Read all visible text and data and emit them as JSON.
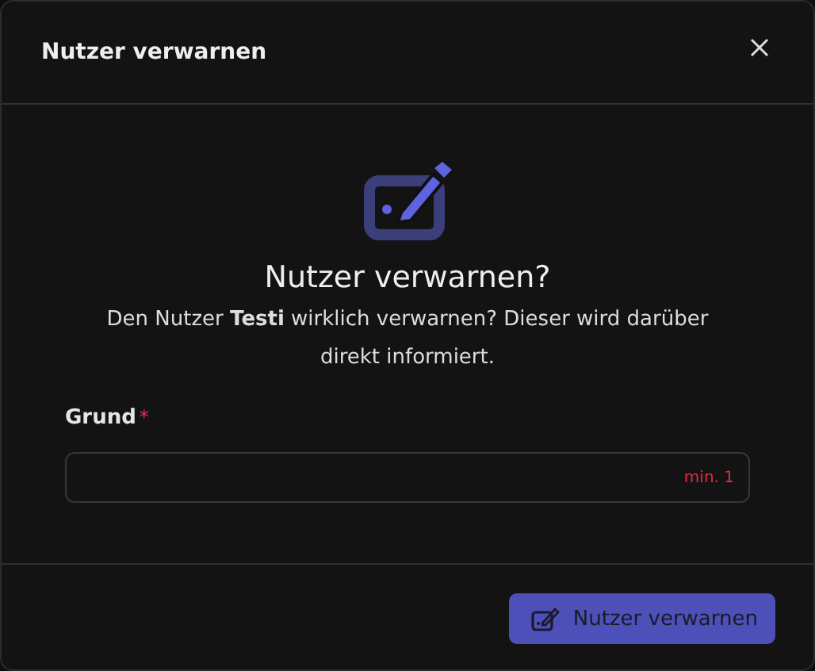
{
  "dialog": {
    "title": "Nutzer verwarnen"
  },
  "prompt": {
    "heading": "Nutzer verwarnen?",
    "message": "Den Nutzer **Testi** wirklich verwarnen? Dieser wird darüber direkt informiert."
  },
  "field": {
    "label": "Grund",
    "required_mark": "*",
    "hint": "min. 1"
  },
  "buttons": [
    {
      "label": "Nutzer verwarnen",
      "disabled": true
    }
  ]
}
